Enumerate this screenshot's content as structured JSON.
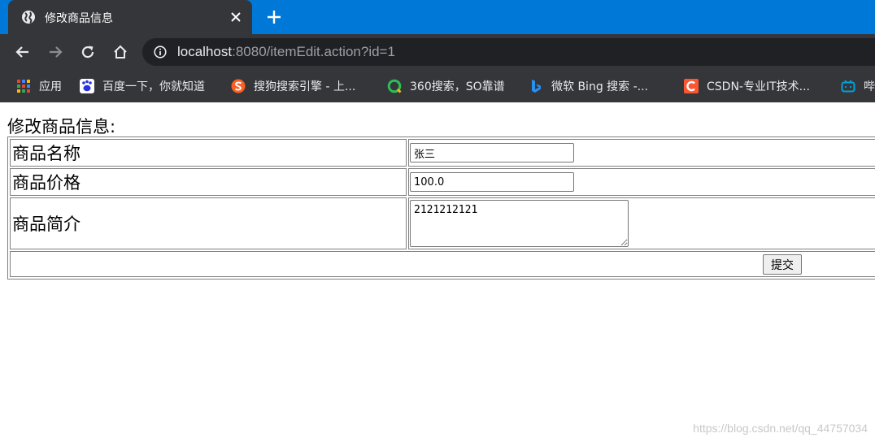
{
  "browser": {
    "tab": {
      "title": "修改商品信息",
      "favicon": "globe-icon"
    },
    "new_tab_icon": "plus-icon",
    "nav_icons": [
      "back-arrow-icon",
      "forward-arrow-icon",
      "reload-icon",
      "home-icon"
    ],
    "address_bar": {
      "host": "localhost",
      "rest": ":8080/itemEdit.action?id=1",
      "icon": "info-icon"
    },
    "bookmarks": [
      {
        "label": "应用",
        "icon": "apps-grid-icon"
      },
      {
        "label": "百度一下，你就知道",
        "icon": "baidu-paw-icon"
      },
      {
        "label": "搜狗搜索引擎 - 上...",
        "icon": "sogou-icon"
      },
      {
        "label": "360搜索，SO靠谱",
        "icon": "360-search-icon"
      },
      {
        "label": "微软 Bing 搜索 -...",
        "icon": "bing-icon"
      },
      {
        "label": "CSDN-专业IT技术...",
        "icon": "csdn-icon"
      },
      {
        "label": "哔",
        "icon": "bilibili-icon"
      }
    ]
  },
  "page": {
    "caption": "修改商品信息:",
    "fields": {
      "name": {
        "label": "商品名称",
        "value": "张三"
      },
      "price": {
        "label": "商品价格",
        "value": "100.0"
      },
      "detail": {
        "label": "商品简介",
        "value": "2121212121"
      }
    },
    "submit_label": "提交"
  },
  "watermark": "https://blog.csdn.net/qq_44757034",
  "colors": {
    "tabstrip": "#0078d7",
    "chrome": "#35363a",
    "omnibox": "#202124"
  }
}
